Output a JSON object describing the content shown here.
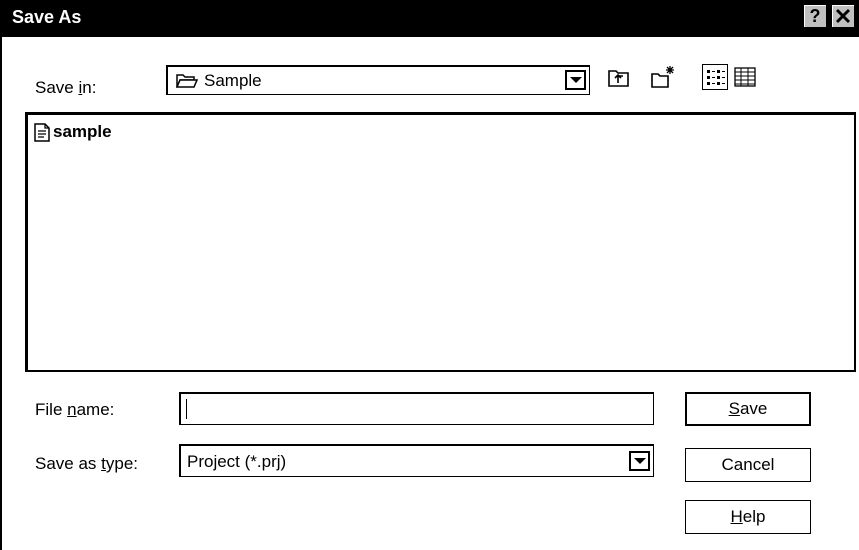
{
  "window": {
    "title": "Save As",
    "help_button": "?",
    "close_button": "×"
  },
  "save_in": {
    "label_pre": "Save ",
    "label_hot": "i",
    "label_post": "n:",
    "value": "Sample",
    "folder_icon": "open-folder-icon"
  },
  "toolbar": {
    "items": [
      "up-one-level-icon",
      "new-folder-icon",
      "list-view-icon",
      "details-view-icon"
    ]
  },
  "files": [
    {
      "name": "sample",
      "icon": "document-icon"
    }
  ],
  "file_name": {
    "label_pre": "File ",
    "label_hot": "n",
    "label_post": "ame:",
    "value": ""
  },
  "save_as_type": {
    "label_pre": "Save as ",
    "label_hot": "t",
    "label_post": "ype:",
    "value": "Project (*.prj)"
  },
  "buttons": {
    "save_hot": "S",
    "save_rest": "ave",
    "cancel": "Cancel",
    "help_hot": "H",
    "help_rest": "elp"
  }
}
